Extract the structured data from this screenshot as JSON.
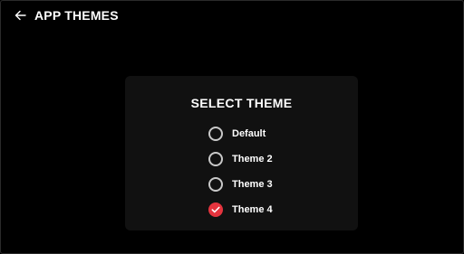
{
  "header": {
    "back_icon": "arrow-left-icon",
    "title": "APP THEMES"
  },
  "card": {
    "title": "SELECT THEME",
    "options": [
      {
        "label": "Default",
        "selected": false
      },
      {
        "label": "Theme 2",
        "selected": false
      },
      {
        "label": "Theme 3",
        "selected": false
      },
      {
        "label": "Theme 4",
        "selected": true
      }
    ]
  },
  "colors": {
    "background": "#000000",
    "card_background": "#111111",
    "accent": "#e5343e",
    "radio_border": "#c9c9c9",
    "text": "#ffffff"
  }
}
